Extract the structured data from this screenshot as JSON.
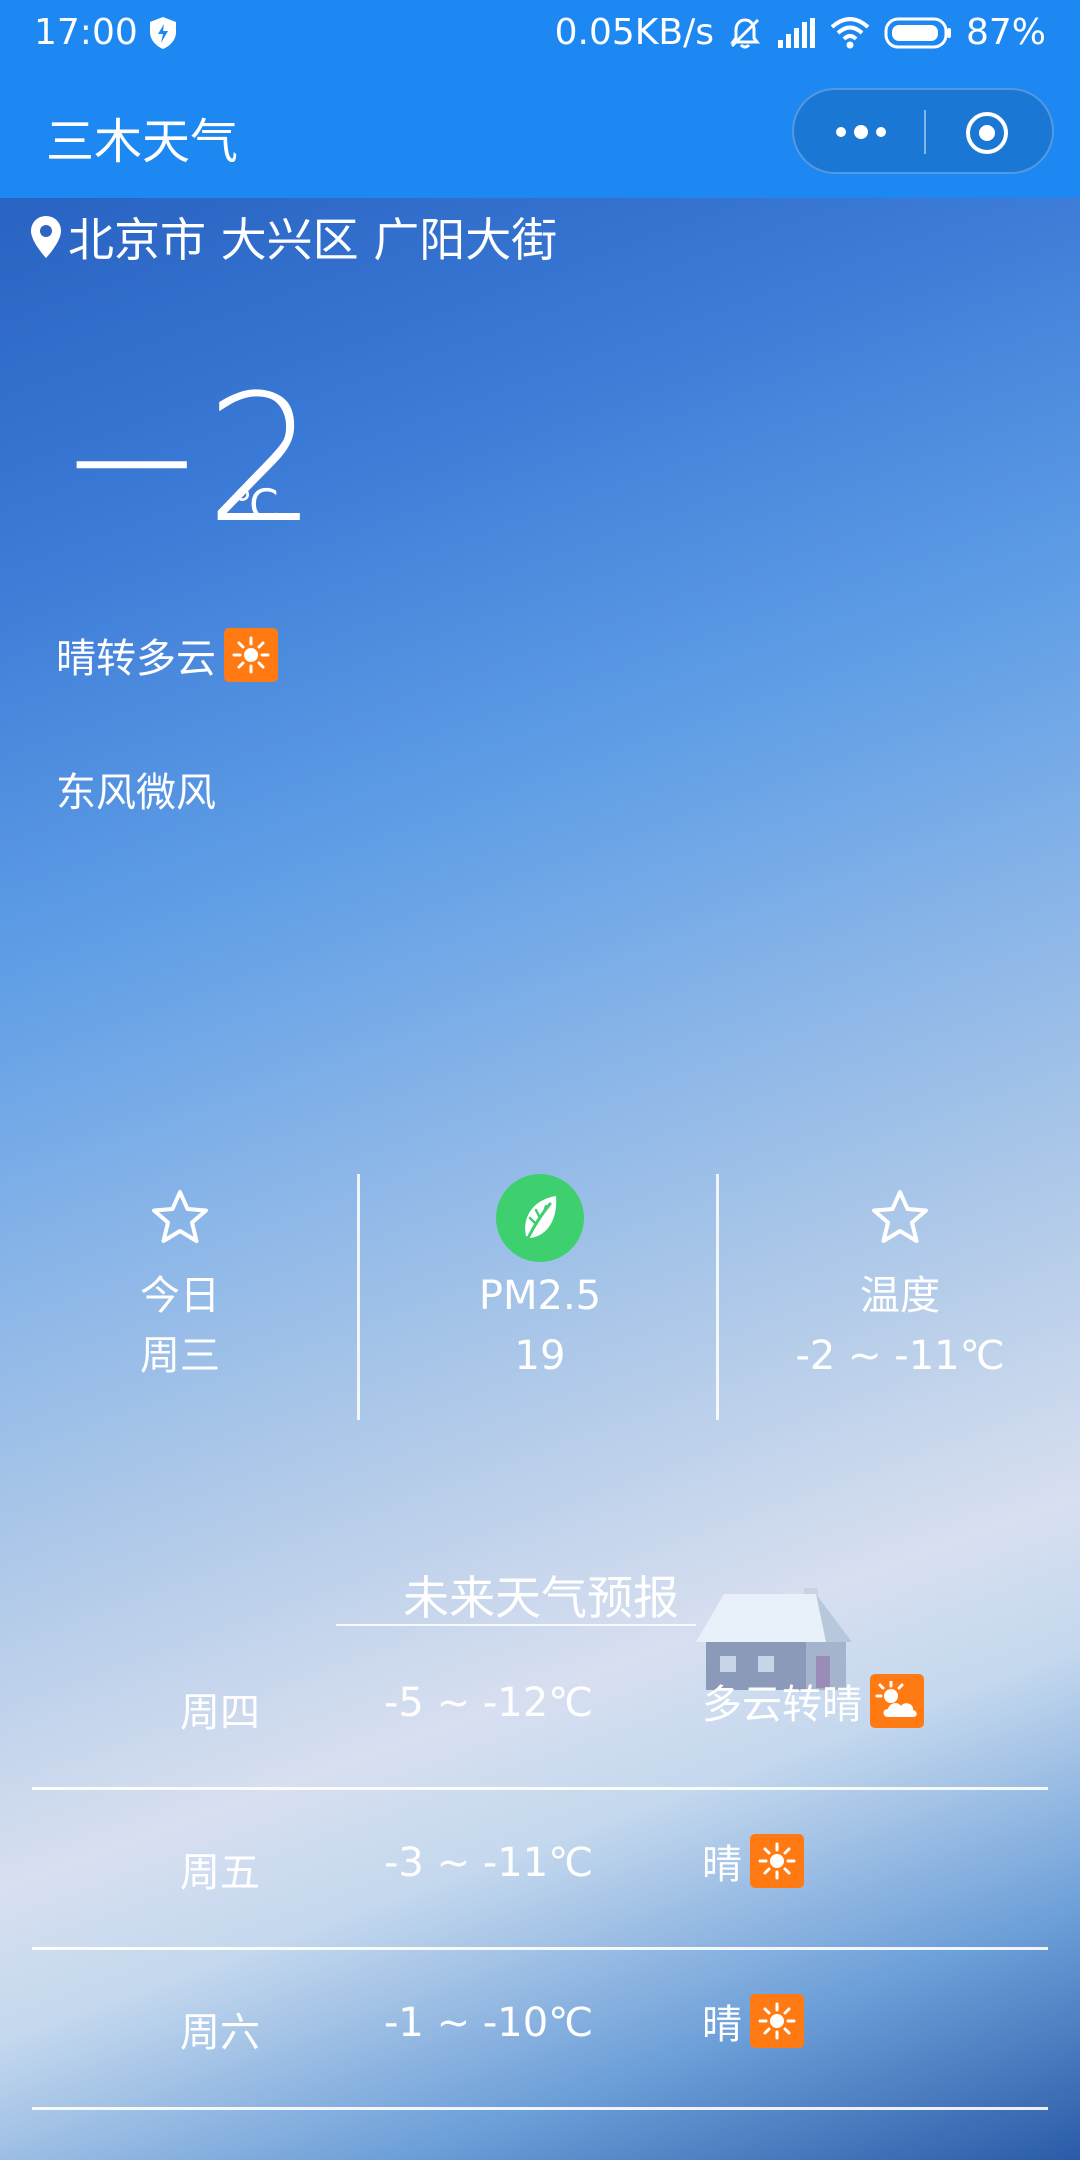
{
  "status_bar": {
    "time": "17:00",
    "net_speed": "0.05KB/s",
    "battery": "87%"
  },
  "title_bar": {
    "app_title": "三木天气"
  },
  "location": "北京市 大兴区 广阳大街",
  "current": {
    "temp": "−2",
    "unit": "℃",
    "condition": "晴转多云",
    "wind": "东风微风"
  },
  "stats": [
    {
      "icon": "star-icon",
      "line1": "今日",
      "line2": "周三"
    },
    {
      "icon": "leaf-icon",
      "line1": "PM2.5",
      "line2": "19"
    },
    {
      "icon": "star-icon",
      "line1": "温度",
      "line2": "-2 ~ -11℃"
    }
  ],
  "forecast": {
    "title": "未来天气预报",
    "rows": [
      {
        "day": "周四",
        "range": "-5 ~ -12℃",
        "condition": "多云转晴",
        "icon": "partly-cloudy-icon"
      },
      {
        "day": "周五",
        "range": "-3 ~ -11℃",
        "condition": "晴",
        "icon": "sun-icon"
      },
      {
        "day": "周六",
        "range": "-1 ~ -10℃",
        "condition": "晴",
        "icon": "sun-icon"
      }
    ]
  },
  "colors": {
    "header": "#1e88f2",
    "sun_badge": "#ff7a12",
    "leaf_badge": "#3ecf6e"
  }
}
